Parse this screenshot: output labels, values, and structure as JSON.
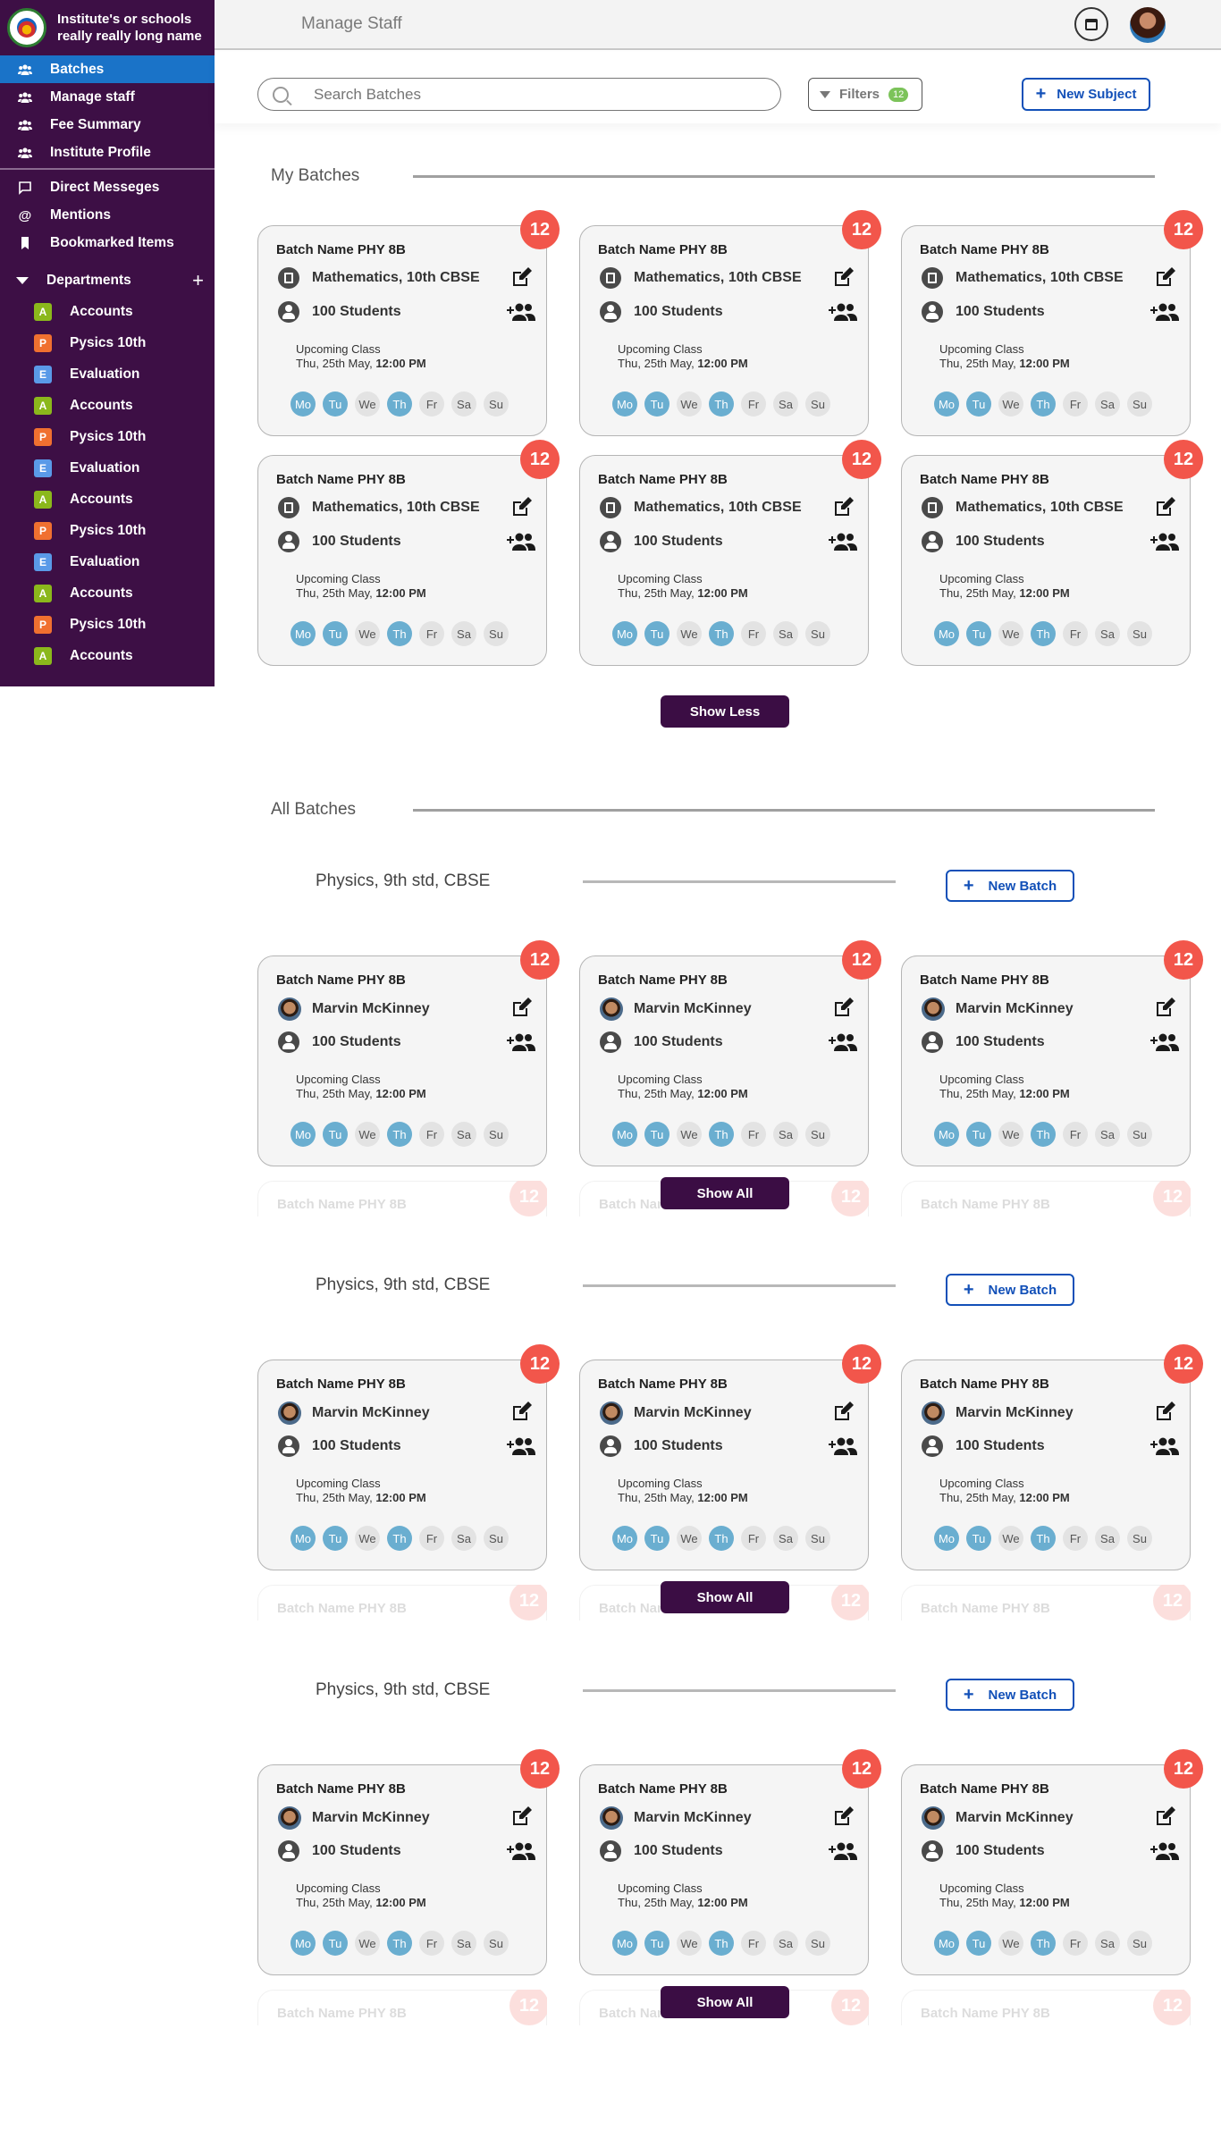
{
  "sidebar": {
    "institute_name_line1": "Institute's or schools",
    "institute_name_line2": "really really long name",
    "nav": [
      {
        "label": "Batches",
        "icon": "group-icon"
      },
      {
        "label": "Manage staff",
        "icon": "group-icon"
      },
      {
        "label": "Fee Summary",
        "icon": "group-icon"
      },
      {
        "label": "Institute Profile",
        "icon": "group-icon"
      }
    ],
    "secondary": [
      {
        "label": "Direct Messeges",
        "icon": "chat-icon"
      },
      {
        "label": "Mentions",
        "icon": "at-icon"
      },
      {
        "label": "Bookmarked Items",
        "icon": "bookmark-icon"
      }
    ],
    "departments_label": "Departments",
    "departments": [
      {
        "letter": "A",
        "label": "Accounts",
        "color": "#8bb81c"
      },
      {
        "letter": "P",
        "label": "Pysics 10th",
        "color": "#f07030"
      },
      {
        "letter": "E",
        "label": "Evaluation",
        "color": "#5a9ae8"
      },
      {
        "letter": "A",
        "label": "Accounts",
        "color": "#8bb81c"
      },
      {
        "letter": "P",
        "label": "Pysics 10th",
        "color": "#f07030"
      },
      {
        "letter": "E",
        "label": "Evaluation",
        "color": "#5a9ae8"
      },
      {
        "letter": "A",
        "label": "Accounts",
        "color": "#8bb81c"
      },
      {
        "letter": "P",
        "label": "Pysics 10th",
        "color": "#f07030"
      },
      {
        "letter": "E",
        "label": "Evaluation",
        "color": "#5a9ae8"
      },
      {
        "letter": "A",
        "label": "Accounts",
        "color": "#8bb81c"
      },
      {
        "letter": "P",
        "label": "Pysics 10th",
        "color": "#f07030"
      },
      {
        "letter": "A",
        "label": "Accounts",
        "color": "#8bb81c"
      }
    ]
  },
  "header": {
    "title": "Manage Staff"
  },
  "toolbar": {
    "search_placeholder": "Search Batches",
    "filters_label": "Filters",
    "filters_count": "12",
    "new_subject_label": "New Subject"
  },
  "my_batches": {
    "title": "My Batches",
    "show_less_label": "Show Less",
    "cards": [
      {
        "count": "12",
        "name": "Batch Name PHY 8B",
        "subject": "Mathematics, 10th CBSE",
        "students": "100 Students",
        "upcoming_label": "Upcoming Class",
        "upcoming_date": "Thu, 25th May,",
        "upcoming_time": "12:00 PM"
      },
      {
        "count": "12",
        "name": "Batch Name PHY 8B",
        "subject": "Mathematics, 10th CBSE",
        "students": "100 Students",
        "upcoming_label": "Upcoming Class",
        "upcoming_date": "Thu, 25th May,",
        "upcoming_time": "12:00 PM"
      },
      {
        "count": "12",
        "name": "Batch Name PHY 8B",
        "subject": "Mathematics, 10th CBSE",
        "students": "100 Students",
        "upcoming_label": "Upcoming Class",
        "upcoming_date": "Thu, 25th May,",
        "upcoming_time": "12:00 PM"
      },
      {
        "count": "12",
        "name": "Batch Name PHY 8B",
        "subject": "Mathematics, 10th CBSE",
        "students": "100 Students",
        "upcoming_label": "Upcoming Class",
        "upcoming_date": "Thu, 25th May,",
        "upcoming_time": "12:00 PM"
      },
      {
        "count": "12",
        "name": "Batch Name PHY 8B",
        "subject": "Mathematics, 10th CBSE",
        "students": "100 Students",
        "upcoming_label": "Upcoming Class",
        "upcoming_date": "Thu, 25th May,",
        "upcoming_time": "12:00 PM"
      },
      {
        "count": "12",
        "name": "Batch Name PHY 8B",
        "subject": "Mathematics, 10th CBSE",
        "students": "100 Students",
        "upcoming_label": "Upcoming Class",
        "upcoming_date": "Thu, 25th May,",
        "upcoming_time": "12:00 PM"
      }
    ]
  },
  "days": [
    {
      "label": "Mo",
      "active": true
    },
    {
      "label": "Tu",
      "active": true
    },
    {
      "label": "We",
      "active": false
    },
    {
      "label": "Th",
      "active": true
    },
    {
      "label": "Fr",
      "active": false
    },
    {
      "label": "Sa",
      "active": false
    },
    {
      "label": "Su",
      "active": false
    }
  ],
  "all_batches": {
    "title": "All Batches",
    "groups": [
      {
        "title": "Physics, 9th std, CBSE",
        "new_batch_label": "New Batch",
        "show_all_label": "Show All",
        "cards": [
          {
            "count": "12",
            "name": "Batch Name PHY 8B",
            "teacher": "Marvin McKinney",
            "students": "100 Students",
            "upcoming_label": "Upcoming Class",
            "upcoming_date": "Thu, 25th May,",
            "upcoming_time": "12:00 PM"
          },
          {
            "count": "12",
            "name": "Batch Name PHY 8B",
            "teacher": "Marvin McKinney",
            "students": "100 Students",
            "upcoming_label": "Upcoming Class",
            "upcoming_date": "Thu, 25th May,",
            "upcoming_time": "12:00 PM"
          },
          {
            "count": "12",
            "name": "Batch Name PHY 8B",
            "teacher": "Marvin McKinney",
            "students": "100 Students",
            "upcoming_label": "Upcoming Class",
            "upcoming_date": "Thu, 25th May,",
            "upcoming_time": "12:00 PM"
          }
        ],
        "peek": [
          {
            "count": "12",
            "name": "Batch Name PHY 8B"
          },
          {
            "count": "12",
            "name": "Batch Name PHY 8B"
          },
          {
            "count": "12",
            "name": "Batch Name PHY 8B"
          }
        ]
      },
      {
        "title": "Physics, 9th std, CBSE",
        "new_batch_label": "New Batch",
        "show_all_label": "Show All",
        "cards": [
          {
            "count": "12",
            "name": "Batch Name PHY 8B",
            "teacher": "Marvin McKinney",
            "students": "100 Students",
            "upcoming_label": "Upcoming Class",
            "upcoming_date": "Thu, 25th May,",
            "upcoming_time": "12:00 PM"
          },
          {
            "count": "12",
            "name": "Batch Name PHY 8B",
            "teacher": "Marvin McKinney",
            "students": "100 Students",
            "upcoming_label": "Upcoming Class",
            "upcoming_date": "Thu, 25th May,",
            "upcoming_time": "12:00 PM"
          },
          {
            "count": "12",
            "name": "Batch Name PHY 8B",
            "teacher": "Marvin McKinney",
            "students": "100 Students",
            "upcoming_label": "Upcoming Class",
            "upcoming_date": "Thu, 25th May,",
            "upcoming_time": "12:00 PM"
          }
        ],
        "peek": [
          {
            "count": "12",
            "name": "Batch Name PHY 8B"
          },
          {
            "count": "12",
            "name": "Batch Name PHY 8B"
          },
          {
            "count": "12",
            "name": "Batch Name PHY 8B"
          }
        ]
      },
      {
        "title": "Physics, 9th std, CBSE",
        "new_batch_label": "New Batch",
        "show_all_label": "Show All",
        "cards": [
          {
            "count": "12",
            "name": "Batch Name PHY 8B",
            "teacher": "Marvin McKinney",
            "students": "100 Students",
            "upcoming_label": "Upcoming Class",
            "upcoming_date": "Thu, 25th May,",
            "upcoming_time": "12:00 PM"
          },
          {
            "count": "12",
            "name": "Batch Name PHY 8B",
            "teacher": "Marvin McKinney",
            "students": "100 Students",
            "upcoming_label": "Upcoming Class",
            "upcoming_date": "Thu, 25th May,",
            "upcoming_time": "12:00 PM"
          },
          {
            "count": "12",
            "name": "Batch Name PHY 8B",
            "teacher": "Marvin McKinney",
            "students": "100 Students",
            "upcoming_label": "Upcoming Class",
            "upcoming_date": "Thu, 25th May,",
            "upcoming_time": "12:00 PM"
          }
        ],
        "peek": [
          {
            "count": "12",
            "name": "Batch Name PHY 8B"
          },
          {
            "count": "12",
            "name": "Batch Name PHY 8B"
          },
          {
            "count": "12",
            "name": "Batch Name PHY 8B"
          }
        ]
      }
    ]
  }
}
